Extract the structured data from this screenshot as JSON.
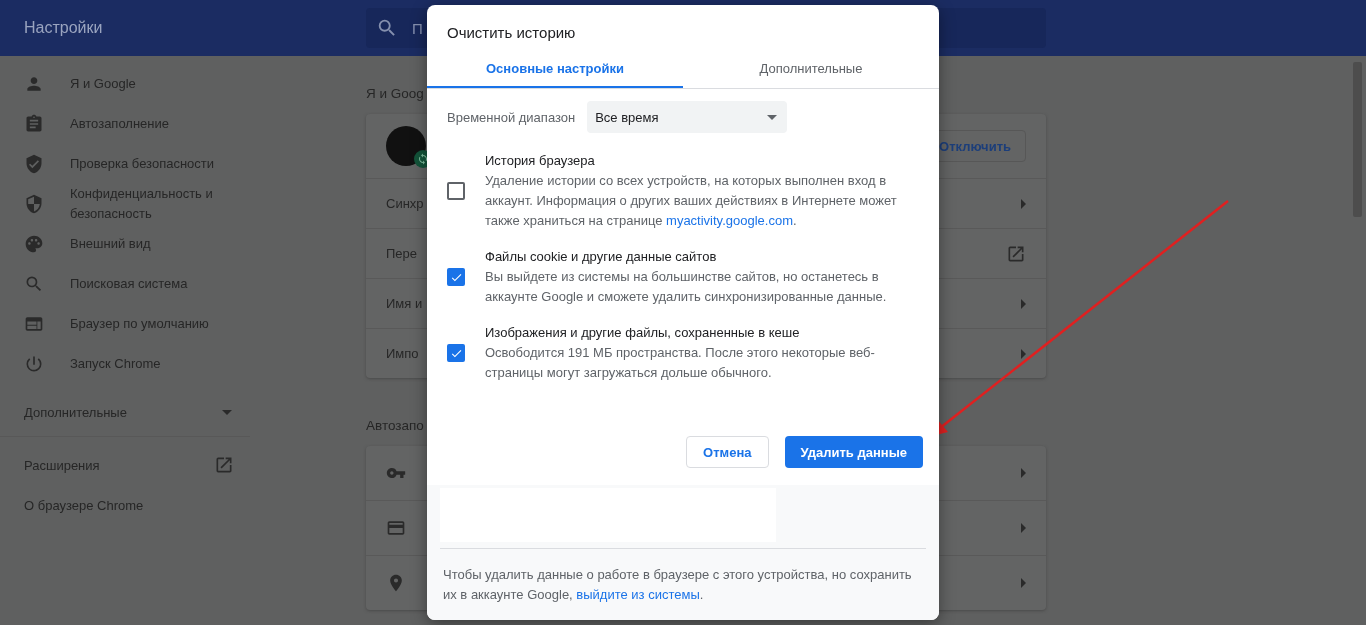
{
  "header": {
    "title": "Настройки",
    "search": {
      "placeholder": "П"
    }
  },
  "sidebar": {
    "items": [
      {
        "label": "Я и Google"
      },
      {
        "label": "Автозаполнение"
      },
      {
        "label": "Проверка безопасности"
      },
      {
        "label": "Конфиденциальность и безопасность"
      },
      {
        "label": "Внешний вид"
      },
      {
        "label": "Поисковая система"
      },
      {
        "label": "Браузер по умолчанию"
      },
      {
        "label": "Запуск Chrome"
      }
    ],
    "advanced": {
      "label": "Дополнительные",
      "expanded": false
    },
    "links": [
      {
        "label": "Расширения",
        "external": true
      },
      {
        "label": "О браузере Chrome",
        "external": false
      }
    ]
  },
  "content": {
    "sections": [
      {
        "heading": "Я и Goog",
        "profile": {
          "button": "Отключить"
        },
        "rows": [
          {
            "label": "Синхр",
            "kind": "arrow"
          },
          {
            "label": "Пере",
            "kind": "external"
          },
          {
            "label": "Имя и",
            "kind": "arrow"
          },
          {
            "label": "Импо",
            "kind": "arrow"
          }
        ]
      },
      {
        "heading": "Автозапо",
        "rows": [
          {
            "kind": "arrow"
          },
          {
            "kind": "arrow"
          },
          {
            "kind": "arrow"
          }
        ]
      }
    ]
  },
  "dialog": {
    "title": "Очистить историю",
    "tabs": [
      {
        "label": "Основные настройки",
        "selected": true
      },
      {
        "label": "Дополнительные",
        "selected": false
      }
    ],
    "range": {
      "label": "Временной диапазон",
      "value": "Все время"
    },
    "options": [
      {
        "title": "История браузера",
        "description": "Удаление истории со всех устройств, на которых выполнен вход в аккаунт. Информация о других ваших действиях в Интернете может также храниться на странице ",
        "link": "myactivity.google.com",
        "after": ".",
        "checked": false
      },
      {
        "title": "Файлы cookie и другие данные сайтов",
        "description": "Вы выйдете из системы на большинстве сайтов, но останетесь в аккаунте Google и сможете удалить синхронизированные данные.",
        "checked": true
      },
      {
        "title": "Изображения и другие файлы, сохраненные в кеше",
        "description": "Освободится 191 МБ пространства. После этого некоторые веб-страницы могут загружаться дольше обычного.",
        "checked": true
      }
    ],
    "buttons": {
      "cancel": "Отмена",
      "confirm": "Удалить данные"
    },
    "footer": {
      "text": "Чтобы удалить данные о работе в браузере с этого устройства, но сохранить их в аккаунте Google, ",
      "link": "выйдите из системы",
      "after": "."
    }
  }
}
